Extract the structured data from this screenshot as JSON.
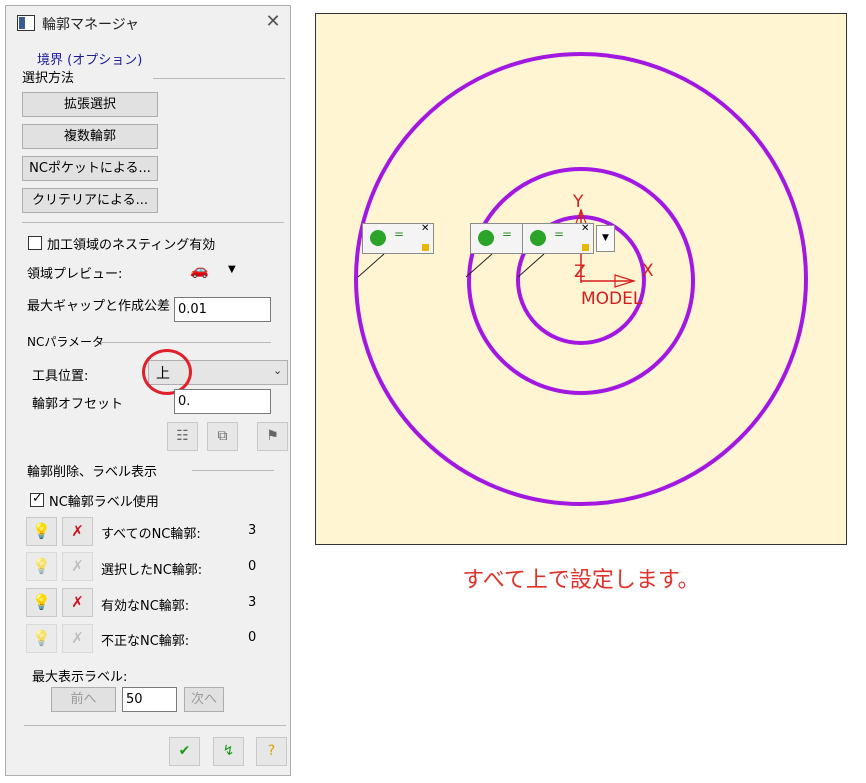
{
  "dialog": {
    "title": "輪郭マネージャ",
    "close_glyph": "✕",
    "boundary_title": "境界 (オプション)",
    "selection_method_title": "選択方法",
    "buttons": {
      "extended": "拡張選択",
      "multi": "複数輪郭",
      "nc_pocket": "NCポケットによる...",
      "criteria": "クリテリアによる..."
    },
    "nesting_label": "加工領域のネスティング有効",
    "nesting_checked": false,
    "region_preview_label": "領域プレビュー:",
    "max_gap_label": "最大ギャップと作成公差",
    "max_gap_value": "0.01",
    "nc_params_title": "NCパラメータ",
    "tool_position_label": "工具位置:",
    "tool_position_value": "上",
    "contour_offset_label": "輪郭オフセット",
    "contour_offset_value": "0.",
    "delete_title": "輪郭削除、ラベル表示",
    "use_labels_label": "NC輪郭ラベル使用",
    "use_labels_checked": true,
    "rows": [
      {
        "label": "すべてのNC輪郭:",
        "count": "3",
        "enabled": true
      },
      {
        "label": "選択したNC輪郭:",
        "count": "0",
        "enabled": false
      },
      {
        "label": "有効なNC輪郭:",
        "count": "3",
        "enabled": true
      },
      {
        "label": "不正なNC輪郭:",
        "count": "0",
        "enabled": false
      }
    ],
    "max_labels_title": "最大表示ラベル:",
    "prev_label": "前へ",
    "next_label": "次へ",
    "max_labels_value": "50"
  },
  "viewport": {
    "axis_y": "Y",
    "axis_x": "X",
    "axis_z": "Z",
    "model_label": "MODEL",
    "tag_symbol": "=",
    "colors": {
      "background": "#fff5d3",
      "contour": "#a318e0",
      "axis": "#d41e1e"
    }
  },
  "caption": "すべて上で設定します。",
  "annotation_color": "#e0202a"
}
